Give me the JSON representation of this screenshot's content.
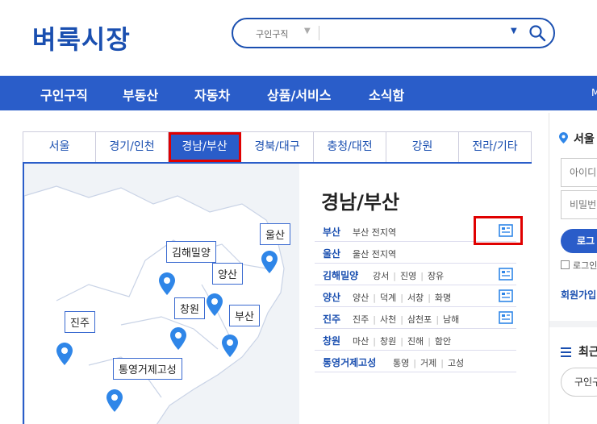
{
  "header": {
    "logo": "벼룩시장",
    "search": {
      "category": "구인구직",
      "placeholder": ""
    }
  },
  "nav": {
    "items": [
      "구인구직",
      "부동산",
      "자동차",
      "상품/서비스",
      "소식함"
    ],
    "edge_label": "M"
  },
  "region_tabs": [
    "서울",
    "경기/인천",
    "경남/부산",
    "경북/대구",
    "충청/대전",
    "강원",
    "전라/기타"
  ],
  "active_tab": "경남/부산",
  "map_pins": [
    "김해밀양",
    "울산",
    "양산",
    "창원",
    "부산",
    "진주",
    "통영거제고성"
  ],
  "region_panel": {
    "title": "경남/부산",
    "rows": [
      {
        "name": "부산",
        "subs": [
          "부산 전지역"
        ],
        "icon": "newspaper-icon"
      },
      {
        "name": "울산",
        "subs": [
          "울산 전지역"
        ],
        "icon": ""
      },
      {
        "name": "김해밀양",
        "subs": [
          "강서",
          "진영",
          "장유"
        ],
        "icon": "newspaper-icon"
      },
      {
        "name": "양산",
        "subs": [
          "양산",
          "덕계",
          "서창",
          "화명"
        ],
        "icon": "newspaper-icon"
      },
      {
        "name": "진주",
        "subs": [
          "진주",
          "사천",
          "삼천포",
          "남해"
        ],
        "icon": "newspaper-icon"
      },
      {
        "name": "창원",
        "subs": [
          "마산",
          "창원",
          "진해",
          "함안"
        ],
        "icon": ""
      },
      {
        "name": "통영거제고성",
        "subs": [
          "통영",
          "거제",
          "고성"
        ],
        "icon": ""
      }
    ]
  },
  "side": {
    "location": "서울",
    "id_placeholder": "아이디",
    "pw_placeholder": "비밀번",
    "login_label": "로그",
    "keep_login": "로그인",
    "join": "회원가입",
    "recent": "최근",
    "recent_tab": "구인구"
  },
  "colors": {
    "brand": "#1a4fb0",
    "nav_bg": "#2a5dc9",
    "highlight": "#e00000"
  }
}
